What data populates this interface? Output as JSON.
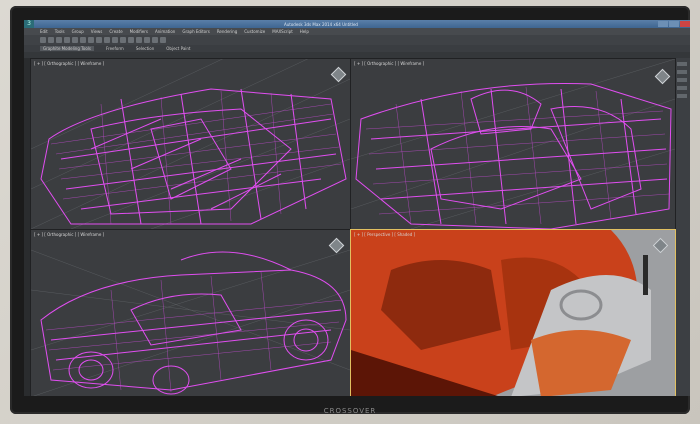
{
  "window": {
    "title": "Autodesk 3ds Max 2014  x64   Untitled",
    "app_logo": "3"
  },
  "menu": {
    "items": [
      "Edit",
      "Tools",
      "Group",
      "Views",
      "Create",
      "Modifiers",
      "Animation",
      "Graph Editors",
      "Rendering",
      "Customize",
      "MAXScript",
      "Help"
    ]
  },
  "ribbon": {
    "tabs": [
      "Graphite Modeling Tools",
      "Freeform",
      "Selection",
      "Object Paint"
    ],
    "sub_label": "Polygon Modeling"
  },
  "viewports": {
    "top_left": {
      "label": "[ + ] [ Orthographic ] [ Wireframe ]"
    },
    "top_right": {
      "label": "[ + ] [ Orthographic ] [ Wireframe ]"
    },
    "bottom_left": {
      "label": "[ + ] [ Orthographic ] [ Wireframe ]"
    },
    "bottom_right": {
      "label": "[ + ] [ Perspective ] [ Shaded ]"
    }
  },
  "monitor": {
    "brand": "CROSSOVER"
  },
  "colors": {
    "wireframe": "#e04ef0",
    "shaded_body": "#c9411b",
    "active_border": "#e1c061"
  },
  "icons": [
    "app-logo-icon",
    "viewcube-icon",
    "minimize-icon",
    "maximize-icon",
    "close-icon"
  ]
}
